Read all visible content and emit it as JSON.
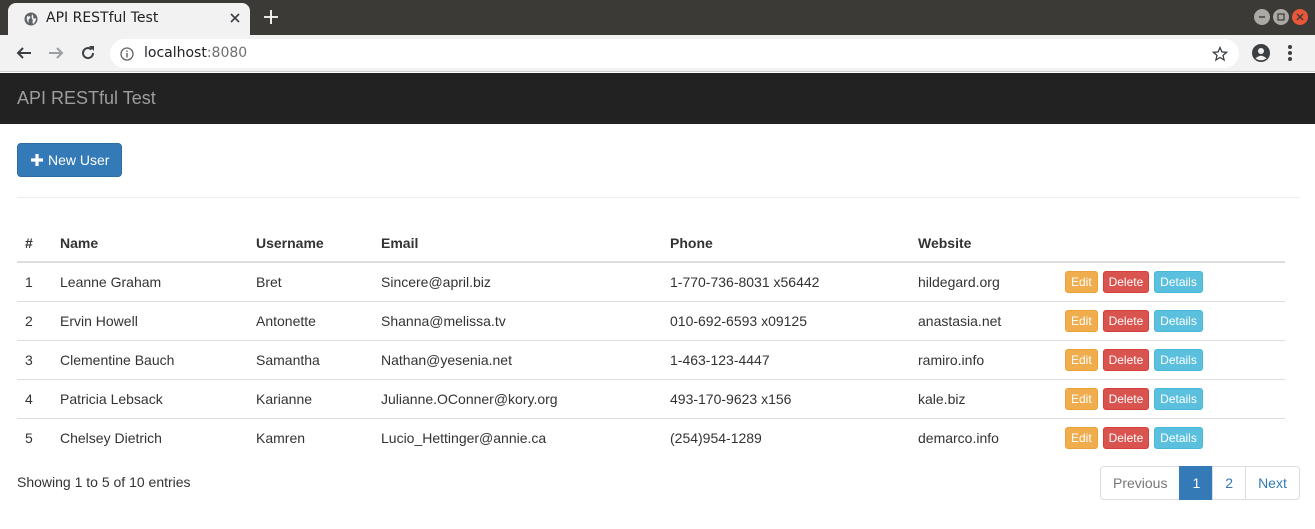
{
  "browser": {
    "tab_title": "API RESTful Test",
    "url_host": "localhost",
    "url_port": ":8080"
  },
  "navbar": {
    "brand": "API RESTful Test"
  },
  "toolbar": {
    "new_user_label": "New User"
  },
  "table": {
    "headers": [
      "#",
      "Name",
      "Username",
      "Email",
      "Phone",
      "Website",
      ""
    ],
    "rows": [
      {
        "id": "1",
        "name": "Leanne Graham",
        "username": "Bret",
        "email": "Sincere@april.biz",
        "phone": "1-770-736-8031 x56442",
        "website": "hildegard.org"
      },
      {
        "id": "2",
        "name": "Ervin Howell",
        "username": "Antonette",
        "email": "Shanna@melissa.tv",
        "phone": "010-692-6593 x09125",
        "website": "anastasia.net"
      },
      {
        "id": "3",
        "name": "Clementine Bauch",
        "username": "Samantha",
        "email": "Nathan@yesenia.net",
        "phone": "1-463-123-4447",
        "website": "ramiro.info"
      },
      {
        "id": "4",
        "name": "Patricia Lebsack",
        "username": "Karianne",
        "email": "Julianne.OConner@kory.org",
        "phone": "493-170-9623 x156",
        "website": "kale.biz"
      },
      {
        "id": "5",
        "name": "Chelsey Dietrich",
        "username": "Kamren",
        "email": "Lucio_Hettinger@annie.ca",
        "phone": "(254)954-1289",
        "website": "demarco.info"
      }
    ],
    "actions": {
      "edit": "Edit",
      "delete": "Delete",
      "details": "Details"
    }
  },
  "footer": {
    "info": "Showing 1 to 5 of 10 entries",
    "pagination": {
      "previous": "Previous",
      "pages": [
        "1",
        "2"
      ],
      "next": "Next"
    }
  },
  "colors": {
    "primary": "#337ab7",
    "edit": "#f0ad4e",
    "delete": "#d9534f",
    "details": "#5bc0de",
    "navbar": "#222222"
  }
}
